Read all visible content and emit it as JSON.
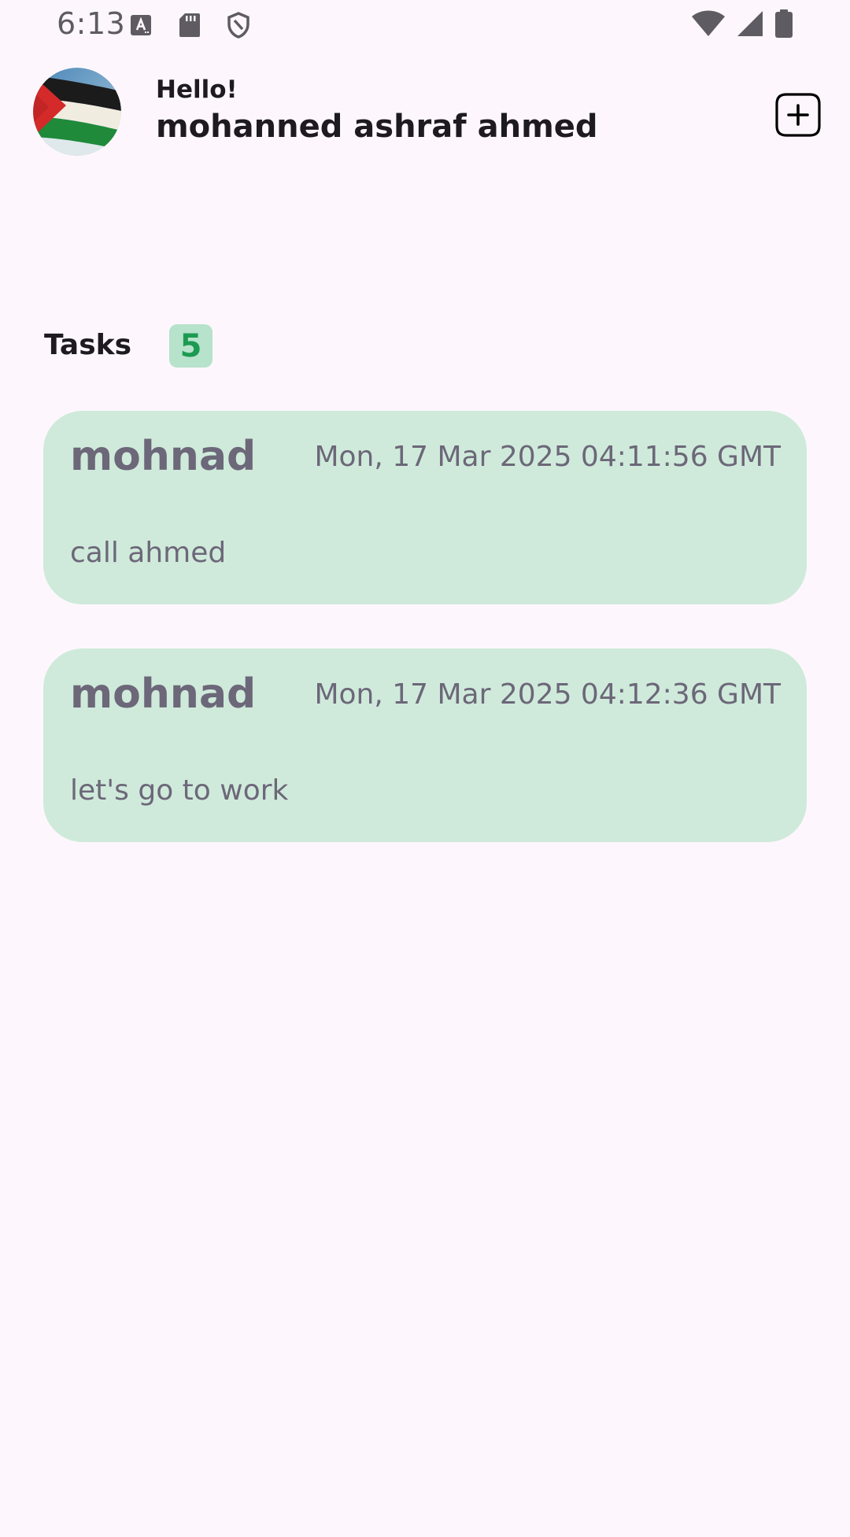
{
  "status_bar": {
    "time": "6:13",
    "left_icons": [
      "font-download-icon",
      "sd-card-icon",
      "shield-icon"
    ],
    "right_icons": [
      "wifi-icon",
      "cellular-signal-icon",
      "battery-icon"
    ]
  },
  "header": {
    "greeting": "Hello!",
    "user_name": "mohanned ashraf ahmed",
    "avatar": "palestine-flag-avatar",
    "add_icon": "add-box-icon"
  },
  "tasks": {
    "label": "Tasks",
    "count": "5",
    "items": [
      {
        "title": "mohnad",
        "date": "Mon, 17 Mar 2025 04:11:56 GMT",
        "description": "call ahmed"
      },
      {
        "title": "mohnad",
        "date": "Mon, 17 Mar 2025 04:12:36 GMT",
        "description": "let's go to work"
      }
    ]
  },
  "colors": {
    "background": "#fdf7fd",
    "card": "#cfeada",
    "badge_bg": "#b7e2cb",
    "badge_text": "#1d9a52",
    "card_text": "#6c6779"
  }
}
